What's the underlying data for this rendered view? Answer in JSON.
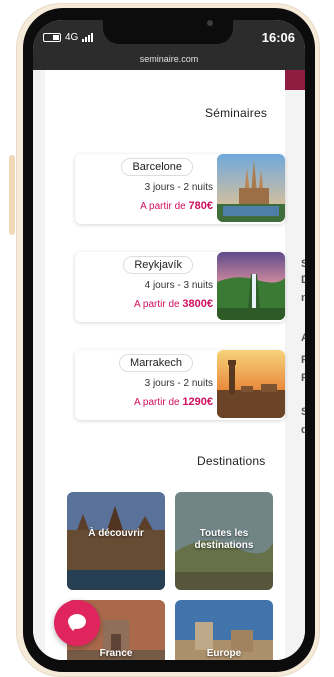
{
  "status": {
    "time": "16:06",
    "network": "4G"
  },
  "browser": {
    "url": "seminaire.com"
  },
  "background_page": {
    "letters": [
      "S",
      "D",
      "n",
      "A",
      "P",
      "P",
      "S",
      "d"
    ]
  },
  "seminaires": {
    "title": "Séminaires",
    "items": [
      {
        "city": "Barcelone",
        "duration": "3 jours - 2 nuits",
        "price_prefix": "A partir de",
        "price": "780€"
      },
      {
        "city": "Reykjavík",
        "duration": "4 jours - 3 nuits",
        "price_prefix": "A partir de",
        "price": "3800€"
      },
      {
        "city": "Marrakech",
        "duration": "3 jours - 2 nuits",
        "price_prefix": "A partir de",
        "price": "1290€"
      }
    ]
  },
  "destinations": {
    "title": "Destinations",
    "tiles": [
      {
        "label_line1": "Toutes les",
        "label_line2": "destinations"
      },
      {
        "label_line1": "À découvrir",
        "label_line2": ""
      },
      {
        "label_line1": "Europe",
        "label_line2": ""
      },
      {
        "label_line1": "France",
        "label_line2": ""
      }
    ]
  },
  "colors": {
    "accent": "#e0245e",
    "price": "#d0105e",
    "header": "#2c2c2c"
  },
  "icons": [
    "chat-icon",
    "battery-icon",
    "signal-icon"
  ]
}
